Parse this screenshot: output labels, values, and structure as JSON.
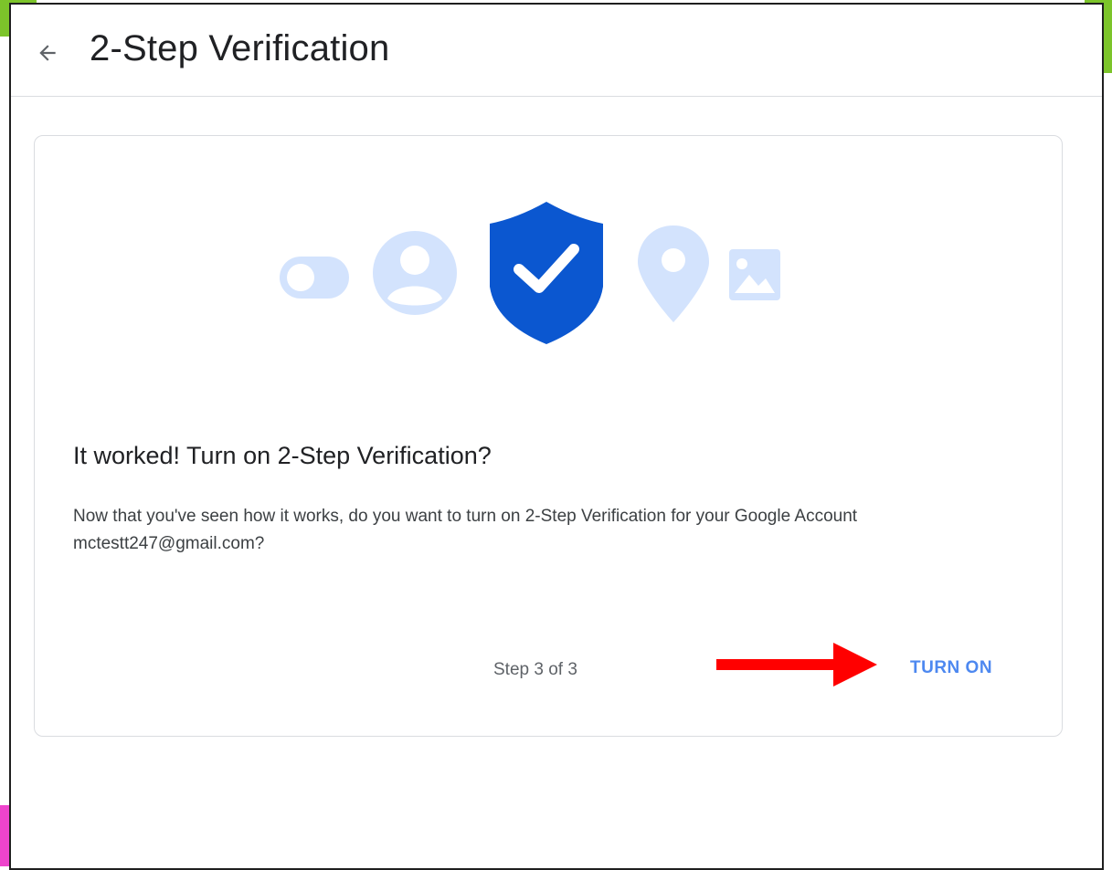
{
  "header": {
    "back_label": "←",
    "title": "2-Step Verification"
  },
  "hero_icons": [
    "toggle-icon",
    "account-circle-icon",
    "shield-check-icon",
    "location-pin-icon",
    "image-icon"
  ],
  "card": {
    "heading": "It worked! Turn on 2-Step Verification?",
    "body": "Now that you've seen how it works, do you want to turn on 2-Step Verification for your Google Account mctestt247@gmail.com?",
    "step_text": "Step 3 of 3",
    "primary_action": "TURN ON"
  },
  "colors": {
    "accent": "#4d88f0",
    "shield": "#0b57d0",
    "icon_light": "#d3e3fd",
    "annotation": "#ff0000"
  }
}
